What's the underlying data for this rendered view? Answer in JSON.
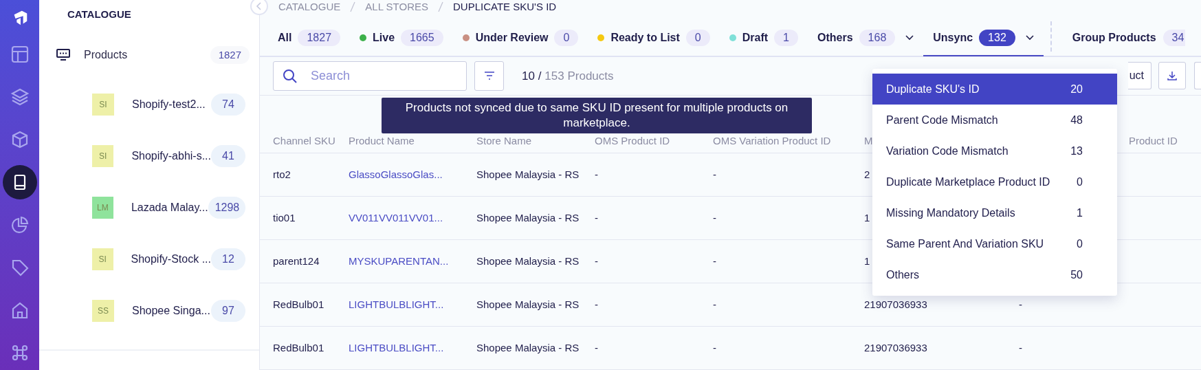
{
  "rail": {
    "items": [
      {
        "selected": false
      },
      {
        "selected": false
      },
      {
        "selected": false
      },
      {
        "selected": true
      },
      {
        "selected": false
      },
      {
        "selected": false
      },
      {
        "selected": false
      },
      {
        "selected": false
      }
    ]
  },
  "panel": {
    "title": "CATALOGUE",
    "products": {
      "label": "Products",
      "count": "1827"
    },
    "stores": [
      {
        "initials": "SI",
        "name": "Shopify-test2...",
        "count": "74",
        "color": "#eef0a8"
      },
      {
        "initials": "SI",
        "name": "Shopify-abhi-s...",
        "count": "41",
        "color": "#eef0a8"
      },
      {
        "initials": "LM",
        "name": "Lazada Malay...",
        "count": "1298",
        "color": "#8fe39c"
      },
      {
        "initials": "SI",
        "name": "Shopify-Stock ...",
        "count": "12",
        "color": "#eef0a8"
      },
      {
        "initials": "SS",
        "name": "Shopee Singa...",
        "count": "97",
        "color": "#eef0a8"
      }
    ]
  },
  "breadcrumb": [
    "CATALOGUE",
    "ALL STORES",
    "DUPLICATE SKU'S ID"
  ],
  "tabs": [
    {
      "label": "All",
      "count": "1827",
      "selected": false,
      "dropdown": false
    },
    {
      "label": "Live",
      "count": "1665",
      "color": "#3cb04a",
      "selected": false,
      "dropdown": false
    },
    {
      "label": "Under Review",
      "count": "0",
      "color": "#c99083",
      "selected": false,
      "dropdown": false
    },
    {
      "label": "Ready to List",
      "count": "0",
      "color": "#f5c911",
      "selected": false,
      "dropdown": false
    },
    {
      "label": "Draft",
      "count": "1",
      "color": "#7fe0d8",
      "selected": false,
      "dropdown": false
    },
    {
      "label": "Others",
      "count": "168",
      "selected": false,
      "dropdown": true
    },
    {
      "label": "Unsync",
      "count": "132",
      "selected": true,
      "dropdown": true
    }
  ],
  "group_tab": {
    "label": "Group Products",
    "count": "34"
  },
  "toolbar": {
    "search_placeholder": "Search",
    "shown": "10 /",
    "total": "153 Products",
    "button_label": "uct"
  },
  "tooltip": "Products not synced due to same SKU ID present for multiple products on marketplace.",
  "table": {
    "columns": [
      "Channel SKU",
      "Product Name",
      "Store Name",
      "OMS Product ID",
      "OMS Variation Product ID",
      "M",
      "Product ID"
    ],
    "rows": [
      [
        "rto2",
        "GlassoGlassoGlas...",
        "Shopee Malaysia - RS",
        "-",
        "-",
        "2",
        ""
      ],
      [
        "tio01",
        "VV011VV011VV01...",
        "Shopee Malaysia - RS",
        "-",
        "-",
        "1",
        ""
      ],
      [
        "parent124",
        "MYSKUPARENTAN...",
        "Shopee Malaysia - RS",
        "-",
        "-",
        "1",
        ""
      ],
      [
        "RedBulb01",
        "LIGHTBULBLIGHT...",
        "Shopee Malaysia - RS",
        "-",
        "-",
        "21907036933",
        "-"
      ],
      [
        "RedBulb01",
        "LIGHTBULBLIGHT...",
        "Shopee Malaysia - RS",
        "-",
        "-",
        "21907036933",
        "-"
      ]
    ]
  },
  "menu": [
    {
      "label": "Duplicate SKU's ID",
      "count": "20",
      "selected": true
    },
    {
      "label": "Parent Code Mismatch",
      "count": "48",
      "selected": false
    },
    {
      "label": "Variation Code Mismatch",
      "count": "13",
      "selected": false
    },
    {
      "label": "Duplicate Marketplace Product ID",
      "count": "0",
      "selected": false
    },
    {
      "label": "Missing Mandatory Details",
      "count": "1",
      "selected": false
    },
    {
      "label": "Same Parent And Variation SKU",
      "count": "0",
      "selected": false
    },
    {
      "label": "Others",
      "count": "50",
      "selected": false
    }
  ]
}
